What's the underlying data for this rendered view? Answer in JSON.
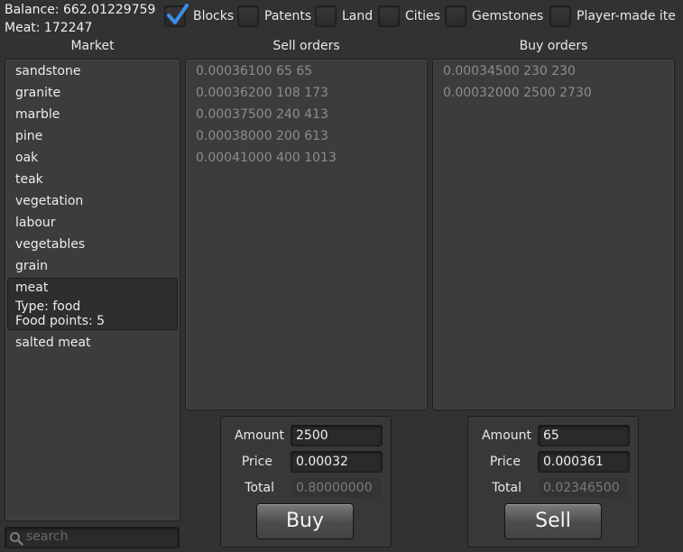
{
  "status": {
    "balance": "Balance: 662.01229759",
    "meat": "Meat: 172247"
  },
  "categories": [
    {
      "label": "Blocks",
      "checked": true
    },
    {
      "label": "Patents",
      "checked": false
    },
    {
      "label": "Land",
      "checked": false
    },
    {
      "label": "Cities",
      "checked": false
    },
    {
      "label": "Gemstones",
      "checked": false
    },
    {
      "label": "Player-made ite",
      "checked": false
    }
  ],
  "columns": {
    "market": "Market",
    "sell_orders": "Sell orders",
    "buy_orders": "Buy orders"
  },
  "market": {
    "items": [
      "sandstone",
      "granite",
      "marble",
      "pine",
      "oak",
      "teak",
      "vegetation",
      "labour",
      "vegetables",
      "grain",
      "meat",
      "salted meat"
    ],
    "selected": {
      "name": "meat",
      "type": "Type: food",
      "food_points": "Food points: 5"
    },
    "search_placeholder": "search"
  },
  "sell_orders": [
    "0.00036100 65 65",
    "0.00036200 108 173",
    "0.00037500 240 413",
    "0.00038000 200 613",
    "0.00041000 400 1013"
  ],
  "buy_orders": [
    "0.00034500 230 230",
    "0.00032000 2500 2730"
  ],
  "buy_panel": {
    "amount_label": "Amount",
    "amount": "2500",
    "price_label": "Price",
    "price": "0.00032",
    "total_label": "Total",
    "total": "0.80000000",
    "button": "Buy"
  },
  "sell_panel": {
    "amount_label": "Amount",
    "amount": "65",
    "price_label": "Price",
    "price": "0.000361",
    "total_label": "Total",
    "total": "0.02346500",
    "button": "Sell"
  },
  "colors": {
    "background": "#323232",
    "panel": "#3c3c3c",
    "check_accent": "#3a8ee6",
    "order_text": "#8c8c8c"
  }
}
